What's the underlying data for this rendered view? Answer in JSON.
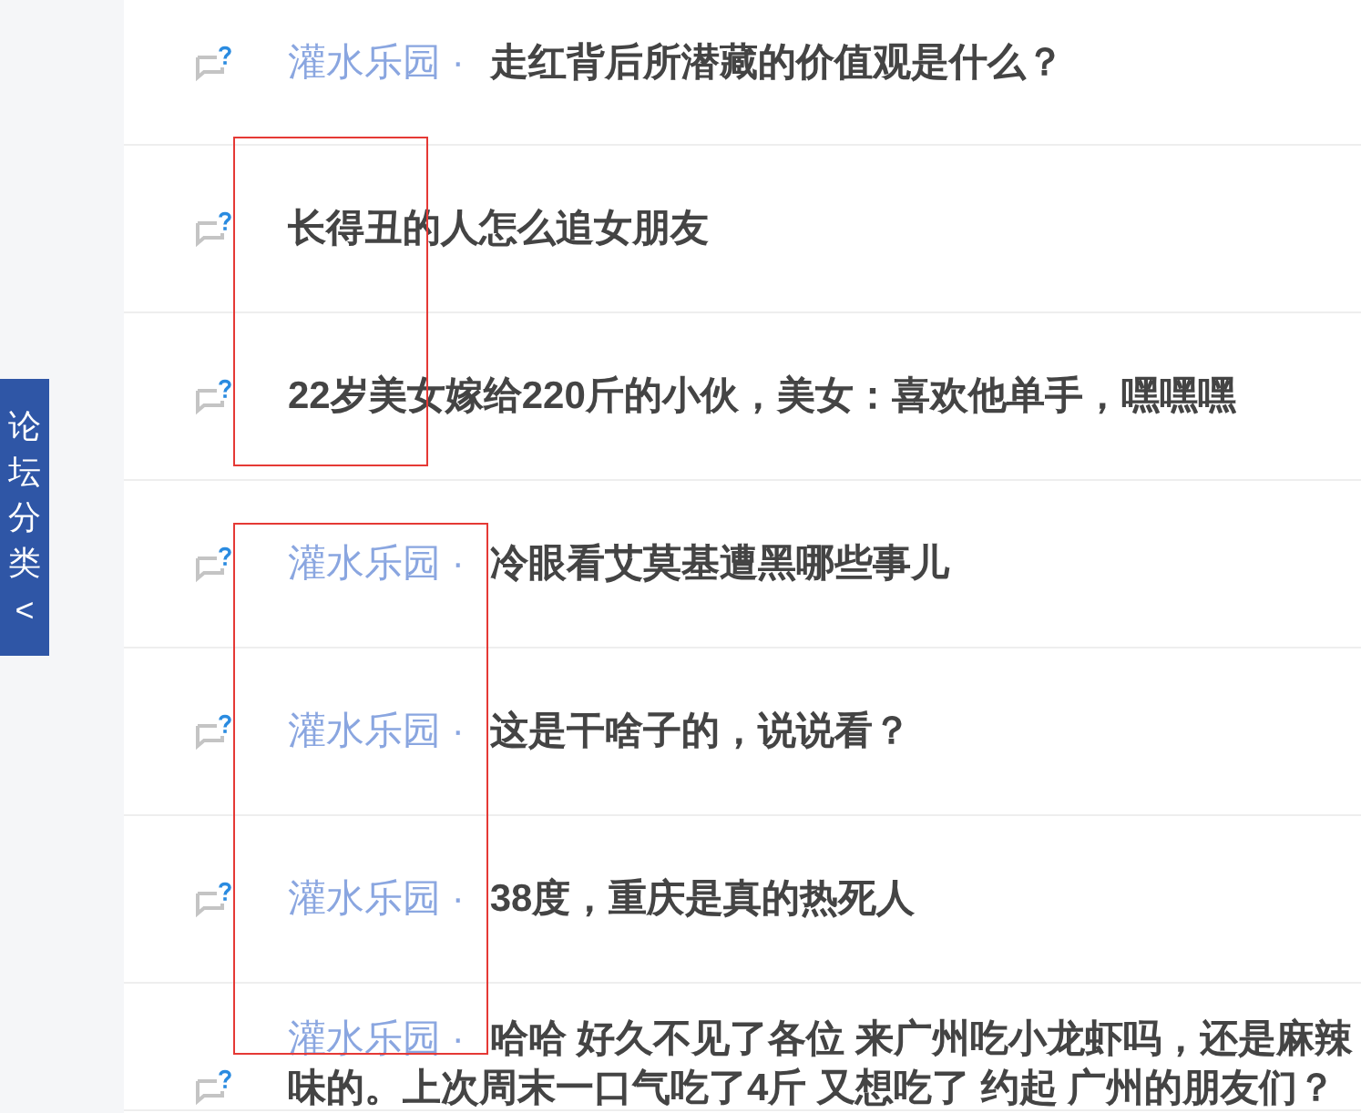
{
  "sidebar_tab": {
    "label": "论坛分类",
    "arrow": "<"
  },
  "threads": [
    {
      "forum": "灌水乐园",
      "separator": "·",
      "title": "走红背后所潜藏的价值观是什么？"
    },
    {
      "title": "长得丑的人怎么追女朋友"
    },
    {
      "title": "22岁美女嫁给220斤的小伙，美女：喜欢他单手，嘿嘿嘿"
    },
    {
      "forum": "灌水乐园",
      "separator": "·",
      "title": "冷眼看艾莫基遭黑哪些事儿"
    },
    {
      "forum": "灌水乐园",
      "separator": "·",
      "title": "这是干啥子的，说说看？"
    },
    {
      "forum": "灌水乐园",
      "separator": "·",
      "title": "38度，重庆是真的热死人"
    },
    {
      "forum": "灌水乐园",
      "separator": "·",
      "title_lines": [
        "哈哈 好久不见了各位 来广州吃小龙虾吗，还是麻辣",
        "味的。上次周末一口气吃了4斤 又想吃了 约起 广州的朋友们？"
      ]
    }
  ]
}
